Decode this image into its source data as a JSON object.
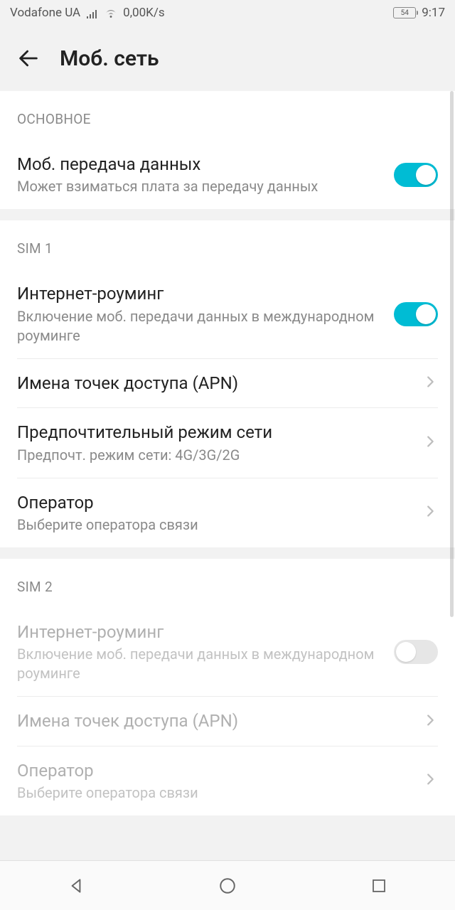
{
  "statusbar": {
    "carrier": "Vodafone UA",
    "data_rate": "0,00K/s",
    "battery_pct": "54",
    "time": "9:17"
  },
  "header": {
    "title": "Моб. сеть"
  },
  "sections": {
    "main": {
      "header": "ОСНОВНОЕ",
      "mobile_data": {
        "title": "Моб. передача данных",
        "sub": "Может взиматься плата за передачу данных",
        "enabled": true
      }
    },
    "sim1": {
      "header": "SIM 1",
      "roaming": {
        "title": "Интернет-роуминг",
        "sub": "Включение моб. передачи данных в международном роуминге",
        "enabled": true
      },
      "apn": {
        "title": "Имена точек доступа (APN)"
      },
      "network_mode": {
        "title": "Предпочтительный режим сети",
        "sub": "Предпочт. режим сети: 4G/3G/2G"
      },
      "operator": {
        "title": "Оператор",
        "sub": "Выберите оператора связи"
      }
    },
    "sim2": {
      "header": "SIM 2",
      "roaming": {
        "title": "Интернет-роуминг",
        "sub": "Включение моб. передачи данных в международном роуминге",
        "enabled": false
      },
      "apn": {
        "title": "Имена точек доступа (APN)"
      },
      "operator": {
        "title": "Оператор",
        "sub": "Выберите оператора связи"
      }
    }
  }
}
